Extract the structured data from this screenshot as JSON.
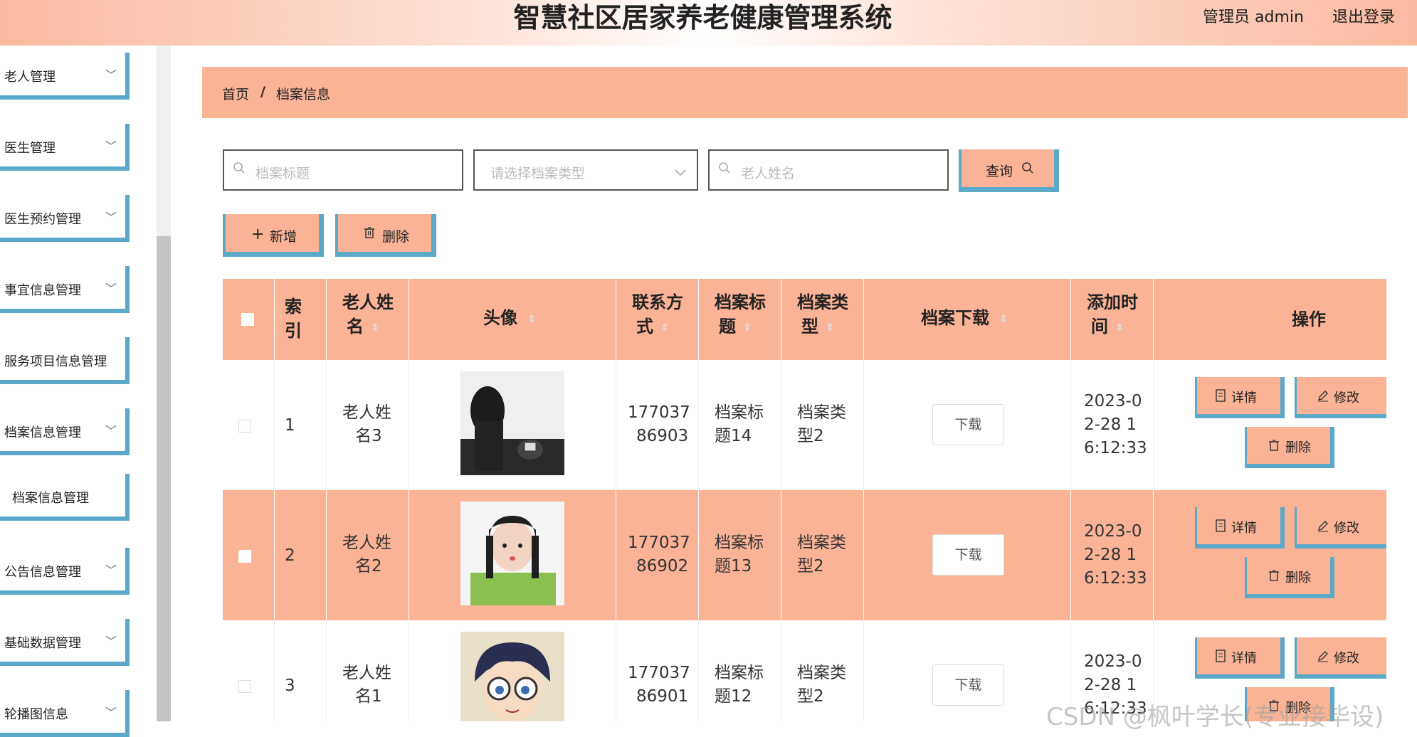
{
  "header": {
    "title": "智慧社区居家养老健康管理系统",
    "user": "管理员 admin",
    "logout": "退出登录"
  },
  "sidebar": {
    "items": [
      {
        "label": "老人管理",
        "chevron": "﹀"
      },
      {
        "label": "医生管理",
        "chevron": "﹀"
      },
      {
        "label": "医生预约管理",
        "chevron": "﹀"
      },
      {
        "label": "事宜信息管理",
        "chevron": "﹀"
      },
      {
        "label": "服务项目信息管理",
        "chevron": ""
      },
      {
        "label": "档案信息管理",
        "chevron": "﹀"
      },
      {
        "label": "档案信息管理",
        "chevron": ""
      },
      {
        "label": "公告信息管理",
        "chevron": "﹀"
      },
      {
        "label": "基础数据管理",
        "chevron": "﹀"
      },
      {
        "label": "轮播图信息",
        "chevron": "﹀"
      }
    ]
  },
  "breadcrumb": {
    "home": "首页",
    "sep": "/",
    "current": "档案信息"
  },
  "search": {
    "title_placeholder": "档案标题",
    "type_placeholder": "请选择档案类型",
    "name_placeholder": "老人姓名",
    "query_label": "查询"
  },
  "toolbar": {
    "add_label": "新增",
    "delete_label": "删除"
  },
  "table": {
    "headers": {
      "index": [
        "索",
        "引"
      ],
      "name": [
        "老人姓",
        "名"
      ],
      "avatar": [
        "头像"
      ],
      "phone": [
        "联系方",
        "式"
      ],
      "title": [
        "档案标",
        "题"
      ],
      "type": [
        "档案类",
        "型"
      ],
      "download": [
        "档案下载"
      ],
      "time": [
        "添加时",
        "间"
      ],
      "ops": [
        "操作"
      ]
    },
    "rows": [
      {
        "index": "1",
        "name": [
          "老人姓",
          "名3"
        ],
        "phone": [
          "177037",
          "86903"
        ],
        "title": [
          "档案标",
          "题14"
        ],
        "type": [
          "档案类",
          "型2"
        ],
        "download": "下载",
        "time": [
          "2023-0",
          "2-28 1",
          "6:12:33"
        ]
      },
      {
        "index": "2",
        "name": [
          "老人姓",
          "名2"
        ],
        "phone": [
          "177037",
          "86902"
        ],
        "title": [
          "档案标",
          "题13"
        ],
        "type": [
          "档案类",
          "型2"
        ],
        "download": "下载",
        "time": [
          "2023-0",
          "2-28 1",
          "6:12:33"
        ]
      },
      {
        "index": "3",
        "name": [
          "老人姓",
          "名1"
        ],
        "phone": [
          "177037",
          "86901"
        ],
        "title": [
          "档案标",
          "题12"
        ],
        "type": [
          "档案类",
          "型2"
        ],
        "download": "下载",
        "time": [
          "2023-0",
          "2-28 1",
          "6:12:33"
        ]
      }
    ],
    "ops": {
      "detail": "详情",
      "edit": "修改",
      "delete": "删除"
    }
  },
  "watermark": "CSDN @枫叶学长(专业接毕设)"
}
